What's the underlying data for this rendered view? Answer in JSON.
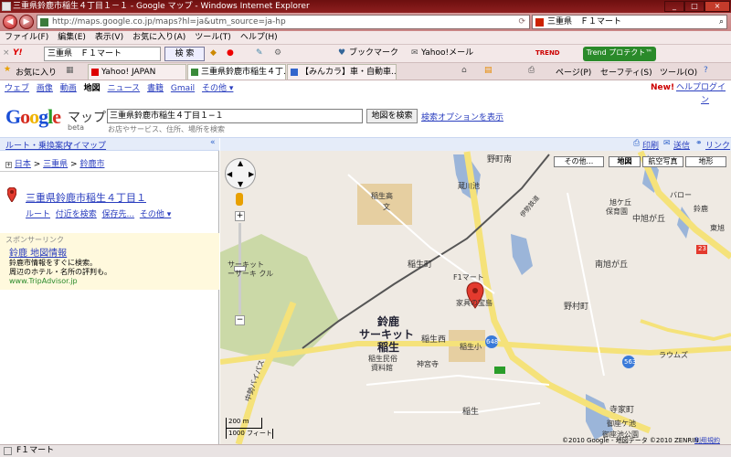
{
  "window": {
    "title": "三重県鈴鹿市稲生４丁目１－１ - Google マップ - Windows Internet Explorer",
    "min": "_",
    "max": "□",
    "close": "×"
  },
  "address_bar": {
    "url": "http://maps.google.co.jp/maps?hl=ja&utm_source=ja-hp",
    "search_text": "三重県　Ｆ１マート"
  },
  "menu": [
    "ファイル(F)",
    "編集(E)",
    "表示(V)",
    "お気に入り(A)",
    "ツール(T)",
    "ヘルプ(H)"
  ],
  "toolbar": {
    "yahoo_text": "三重県　Ｆ１マート",
    "search_button": "検 索",
    "bookmark": "ブックマーク",
    "yahoo_mail": "Yahoo!メール",
    "trend": "TREND",
    "trend_protect": "Trend プロテクト™"
  },
  "tabs_bar": {
    "favorites": "お気に入り",
    "tabs": [
      "Yahoo! JAPAN",
      "三重県鈴鹿市稲生４丁...",
      "【みんカラ】車・自動車..."
    ],
    "page_menu": "ページ(P)",
    "safety_menu": "セーフティ(S)",
    "tools_menu": "ツール(O)"
  },
  "google_nav": {
    "links": [
      "ウェブ",
      "画像",
      "動画",
      "地図",
      "ニュース",
      "書籍",
      "Gmail",
      "その他 ▾"
    ],
    "right_new": "New!",
    "right_links": [
      "ヘルプ",
      "ログイン"
    ]
  },
  "header": {
    "logo": "Google",
    "product": "マップ",
    "beta": "beta",
    "query": "三重県鈴鹿市稲生４丁目１−１",
    "hint": "お店やサービス、住所、場所を検索",
    "search_button": "地図を検索",
    "options_link": "検索オプションを表示"
  },
  "sidebar": {
    "route_link": "ルート・乗換案内",
    "mymap_link": "マイマップ",
    "collapse": "«",
    "breadcrumb": [
      "日本",
      "三重県",
      "鈴鹿市"
    ],
    "result_title": "三重県鈴鹿市稲生４丁目１",
    "result_actions": [
      "ルート",
      "付近を検索",
      "保存先...",
      "その他 ▾"
    ],
    "sponsor_label": "スポンサーリンク",
    "ad_title": "鈴鹿 地図情報",
    "ad_line1": "鈴鹿市情報をすぐに検索。",
    "ad_line2": "周辺のホテル・名所の評判も。",
    "ad_url": "www.TripAdvisor.jp"
  },
  "map_toolbar": {
    "print": "印刷",
    "send": "送信",
    "link": "リンク",
    "more": "その他...",
    "map": "地図",
    "satellite": "航空写真",
    "terrain": "地形"
  },
  "map": {
    "labels": {
      "nobucho_minami": "野町南",
      "koichi": "蔵川池",
      "inou_high": "稲生高",
      "bun": "文",
      "ise_rail": "伊勢鉄道",
      "inou_town": "稲生町",
      "f1mart": "F1マート",
      "kagu": "家具の宝島",
      "suzuka": "鈴鹿",
      "circuit": "サーキット",
      "inou": "稲生",
      "inou_nishi": "稲生西",
      "inou_elem": "稲生小",
      "minzoku": "稲生民俗",
      "shiryokan": "資料館",
      "shinkanji": "神宮寺",
      "inou2": "稲生",
      "circuit_small": "サーキット",
      "circuit_small2": "ーサーキ クル",
      "minamiasahi": "南旭が丘",
      "nomuracho": "野村町",
      "nakaasahi": "中旭が丘",
      "higashi": "東旭",
      "hoikuen": "旭ケ丘",
      "hoikuen2": "保育園",
      "baro": "バロー",
      "suzu": "鈴鹿",
      "ryouhaku": "ラウムズ",
      "tera": "寺家町",
      "gosho": "御座ケ池",
      "gosho_park": "御座池公園",
      "route23": "23",
      "route8": "8",
      "bypass": "中勢バイパス",
      "r563": "563",
      "r648": "648",
      "road_n": "野町",
      "k": "K",
      "seven": "7",
      "scale_m": "200 m",
      "scale_ft": "1000 フィート",
      "copyright": "©2010 Google - 地図データ ©2010 ZENRIN -",
      "terms": "利用規約"
    }
  },
  "statusbar": {
    "text": "F１マート"
  }
}
